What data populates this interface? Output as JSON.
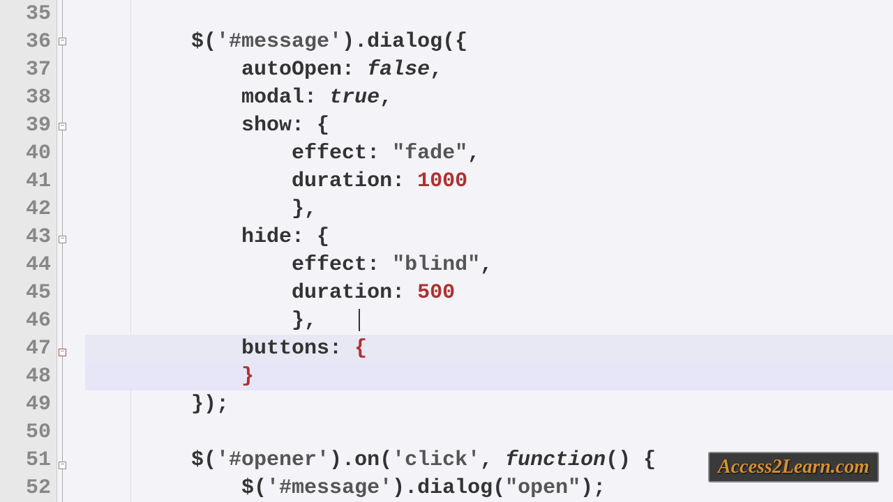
{
  "lines": {
    "start": 35,
    "end": 52
  },
  "code": {
    "l35": "",
    "l36_a": "        $(",
    "l36_b": "'#message'",
    "l36_c": ").dialog({",
    "l37_a": "            autoOpen: ",
    "l37_b": "false",
    "l37_c": ",",
    "l38_a": "            modal: ",
    "l38_b": "true",
    "l38_c": ",",
    "l39": "            show: {",
    "l40_a": "                effect: ",
    "l40_b": "\"fade\"",
    "l40_c": ",",
    "l41_a": "                duration: ",
    "l41_b": "1000",
    "l42": "                },",
    "l43": "            hide: {",
    "l44_a": "                effect: ",
    "l44_b": "\"blind\"",
    "l44_c": ",",
    "l45_a": "                duration: ",
    "l45_b": "500",
    "l46": "                },",
    "l47_a": "            buttons: ",
    "l47_b": "{",
    "l48": "            ",
    "l48_b": "}",
    "l49": "        });",
    "l50": "",
    "l51_a": "        $(",
    "l51_b": "'#opener'",
    "l51_c": ").on(",
    "l51_d": "'click'",
    "l51_e": ", ",
    "l51_f": "function",
    "l51_g": "() {",
    "l52_a": "            $(",
    "l52_b": "'#message'",
    "l52_c": ").dialog(",
    "l52_d": "\"open\"",
    "l52_e": ");"
  },
  "fold_symbol": "−",
  "watermark": "Access2Learn.com",
  "line_numbers": [
    "35",
    "36",
    "37",
    "38",
    "39",
    "40",
    "41",
    "42",
    "43",
    "44",
    "45",
    "46",
    "47",
    "48",
    "49",
    "50",
    "51",
    "52"
  ]
}
